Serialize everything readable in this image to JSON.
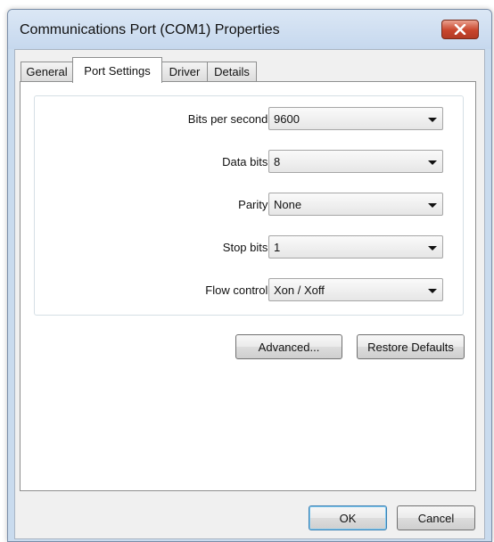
{
  "window": {
    "title": "Communications Port (COM1) Properties"
  },
  "tabs": [
    {
      "label": "General",
      "active": false
    },
    {
      "label": "Port Settings",
      "active": true
    },
    {
      "label": "Driver",
      "active": false
    },
    {
      "label": "Details",
      "active": false
    }
  ],
  "settings": {
    "bits_per_second": {
      "label": "Bits per second:",
      "value": "9600"
    },
    "data_bits": {
      "label": "Data bits:",
      "value": "8"
    },
    "parity": {
      "label": "Parity:",
      "value": "None"
    },
    "stop_bits": {
      "label": "Stop bits:",
      "value": "1"
    },
    "flow_control": {
      "label": "Flow control:",
      "value": "Xon / Xoff"
    }
  },
  "buttons": {
    "advanced": "Advanced...",
    "restore_defaults": "Restore Defaults",
    "ok": "OK",
    "cancel": "Cancel"
  },
  "colors": {
    "close_button": "#c8452c",
    "title_bar": "#c9dbee"
  }
}
